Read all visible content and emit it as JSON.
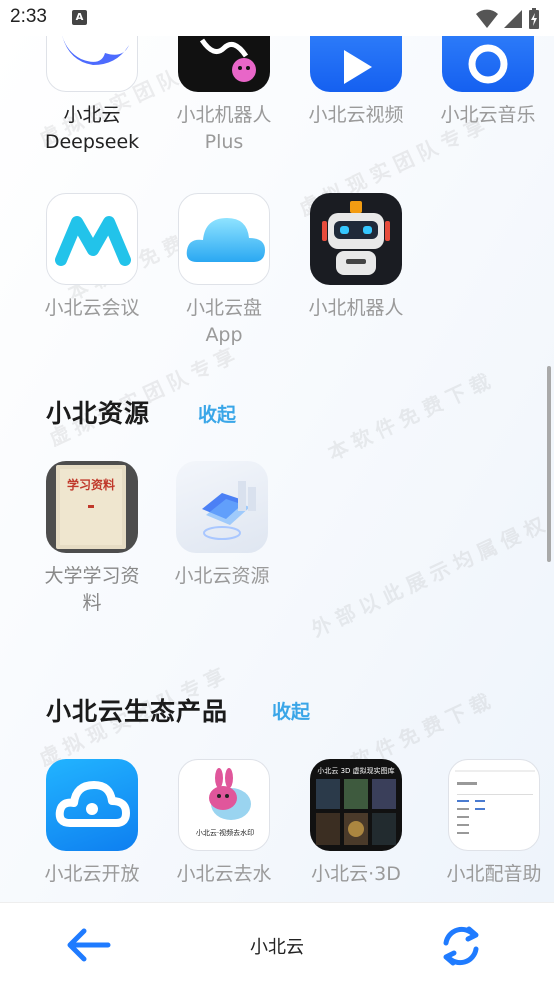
{
  "status_bar": {
    "time": "2:33",
    "notification_letter": "A"
  },
  "row1": [
    {
      "label": "小北云",
      "sub": "Deepseek",
      "dark": true,
      "icon": "deepseek-whale-icon"
    },
    {
      "label": "小北机器人",
      "sub": "Plus",
      "icon": "robot-plus-icon"
    },
    {
      "label": "小北云视频",
      "sub": "",
      "icon": "video-play-icon"
    },
    {
      "label": "小北云音乐",
      "sub": "",
      "icon": "music-icon"
    }
  ],
  "row2": [
    {
      "label": "小北云会议",
      "sub": "",
      "icon": "meeting-m-icon"
    },
    {
      "label": "小北云盘",
      "sub": "App",
      "icon": "cloud-drive-icon"
    },
    {
      "label": "小北机器人",
      "sub": "",
      "icon": "robot-face-icon"
    }
  ],
  "section_resources": {
    "title": "小北资源",
    "toggle": "收起"
  },
  "resources": [
    {
      "label": "大学学习资",
      "sub": "料",
      "icon": "study-book-icon",
      "book_title": "学习资料"
    },
    {
      "label": "小北云资源",
      "sub": "",
      "icon": "resource-folder-icon"
    }
  ],
  "section_ecosystem": {
    "title": "小北云生态产品",
    "toggle": "收起"
  },
  "ecosystem": [
    {
      "label": "小北云开放",
      "icon": "open-cloud-icon"
    },
    {
      "label": "小北云去水",
      "icon": "watermark-remove-icon",
      "caption": "小北云·视频去水印"
    },
    {
      "label": "小北云·3D",
      "icon": "3d-gallery-icon",
      "caption": "小北云 3D 虚拟现实图库"
    },
    {
      "label": "小北配音助",
      "icon": "dubbing-assistant-icon"
    }
  ],
  "watermark_lines": [
    "虚拟现实团队专享",
    "本软件免费下载",
    "外部以此展示均属侵权"
  ],
  "bottom_bar": {
    "title": "小北云"
  },
  "colors": {
    "accent": "#3aa6e8",
    "brand_blue": "#1f7bff"
  }
}
